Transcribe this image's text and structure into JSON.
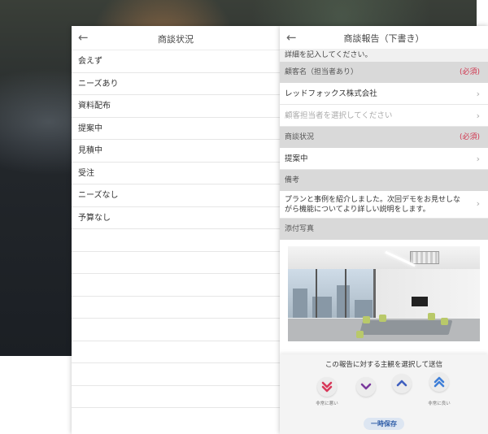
{
  "status_screen": {
    "title": "商談状況",
    "items": [
      "会えず",
      "ニーズあり",
      "資料配布",
      "提案中",
      "見積中",
      "受注",
      "ニーズなし",
      "予算なし"
    ]
  },
  "report_screen": {
    "title": "商談報告（下書き）",
    "note": "詳細を記入してください。",
    "customer_section": "顧客名（担当者あり）",
    "required_label": "(必須)",
    "customer_name": "レッドフォックス株式会社",
    "contact_placeholder": "顧客担当者を選択してください",
    "status_section": "商談状況",
    "status_value": "提案中",
    "remarks_section": "備考",
    "remarks_line1": "プランと事例を紹介しました。次回デモをお見せしな",
    "remarks_line2": "がら機能についてより詳しい説明をします。",
    "photo_section": "添付写真",
    "overlay_title": "この報告に対する主観を選択して送信",
    "label_very_bad": "非常に悪い",
    "label_very_good": "非常に良い",
    "save_label": "一時保存",
    "colors": {
      "very_bad": "#d8395a",
      "bad": "#7a3a9c",
      "good": "#3f5fbf",
      "very_good": "#3f7fd8",
      "required": "#d0344d"
    }
  }
}
